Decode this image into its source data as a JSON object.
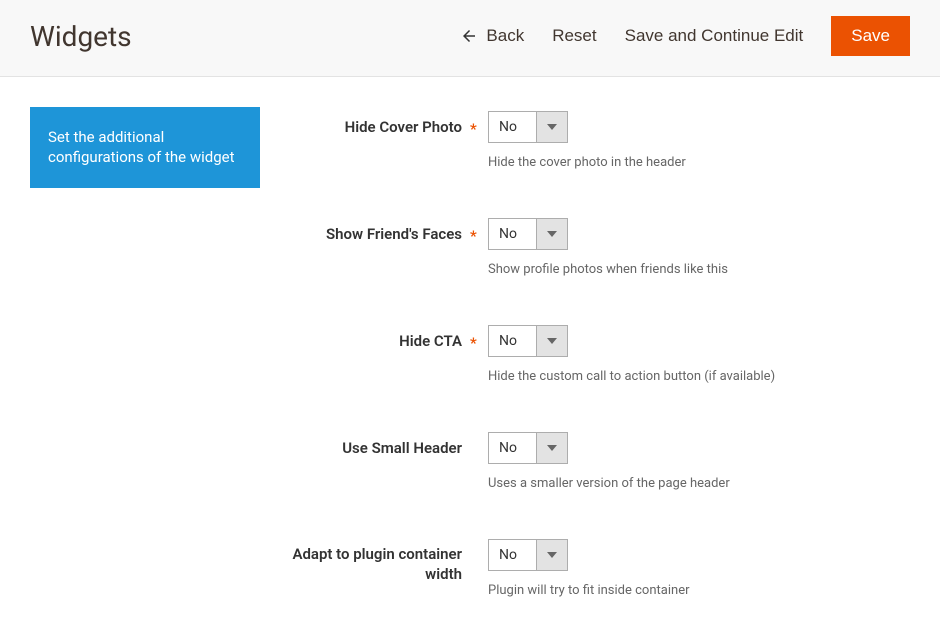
{
  "header": {
    "title": "Widgets",
    "back_label": "Back",
    "reset_label": "Reset",
    "save_continue_label": "Save and Continue Edit",
    "save_label": "Save"
  },
  "sidebar": {
    "tab_label": "Set the additional configurations of the widget"
  },
  "form": {
    "fields": [
      {
        "label": "Hide Cover Photo",
        "required": true,
        "value": "No",
        "help": "Hide the cover photo in the header"
      },
      {
        "label": "Show Friend's Faces",
        "required": true,
        "value": "No",
        "help": "Show profile photos when friends like this"
      },
      {
        "label": "Hide CTA",
        "required": true,
        "value": "No",
        "help": "Hide the custom call to action button (if available)"
      },
      {
        "label": "Use Small Header",
        "required": false,
        "value": "No",
        "help": "Uses a smaller version of the page header"
      },
      {
        "label": "Adapt to plugin container width",
        "required": false,
        "value": "No",
        "help": "Plugin will try to fit inside container"
      }
    ]
  }
}
